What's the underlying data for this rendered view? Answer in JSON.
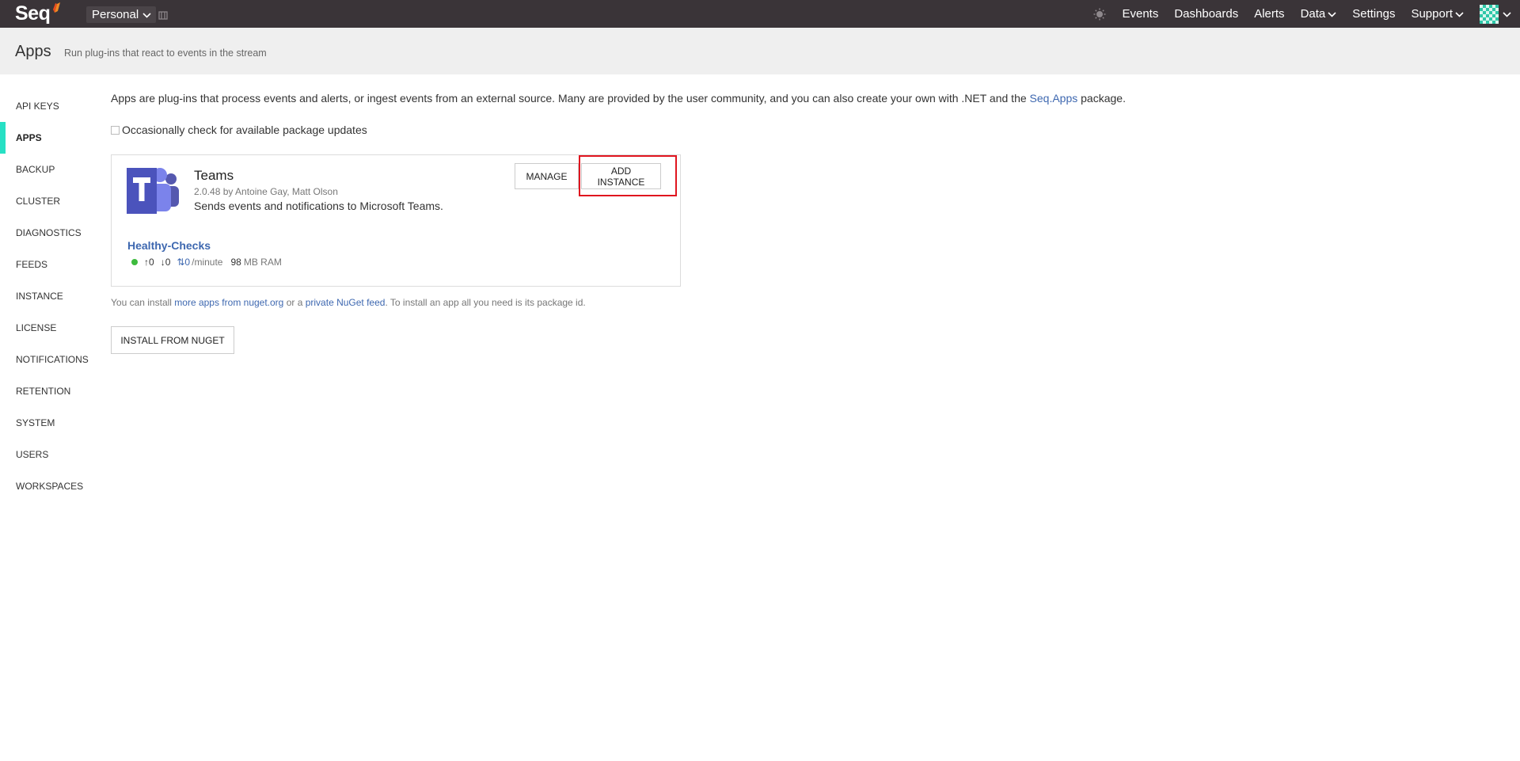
{
  "topbar": {
    "logo_text": "Seq",
    "workspace": "Personal",
    "nav": [
      {
        "label": "Events",
        "has_dropdown": false
      },
      {
        "label": "Dashboards",
        "has_dropdown": false
      },
      {
        "label": "Alerts",
        "has_dropdown": false
      },
      {
        "label": "Data",
        "has_dropdown": true
      },
      {
        "label": "Settings",
        "has_dropdown": false
      },
      {
        "label": "Support",
        "has_dropdown": true
      }
    ]
  },
  "header": {
    "title": "Apps",
    "subtitle": "Run plug-ins that react to events in the stream"
  },
  "sidebar": {
    "items": [
      {
        "label": "API KEYS"
      },
      {
        "label": "APPS",
        "active": true
      },
      {
        "label": "BACKUP"
      },
      {
        "label": "CLUSTER"
      },
      {
        "label": "DIAGNOSTICS"
      },
      {
        "label": "FEEDS"
      },
      {
        "label": "INSTANCE"
      },
      {
        "label": "LICENSE"
      },
      {
        "label": "NOTIFICATIONS"
      },
      {
        "label": "RETENTION"
      },
      {
        "label": "SYSTEM"
      },
      {
        "label": "USERS"
      },
      {
        "label": "WORKSPACES"
      }
    ]
  },
  "main": {
    "intro_before": "Apps are plug-ins that process events and alerts, or ingest events from an external source. Many are provided by the user community, and you can also create your own with .NET and the ",
    "intro_link": "Seq.Apps",
    "intro_after": " package.",
    "check_label": "Occasionally check for available package updates",
    "check_value": false,
    "app": {
      "name": "Teams",
      "meta": "2.0.48 by Antoine Gay, Matt Olson",
      "description": "Sends events and notifications to Microsoft Teams.",
      "manage_label": "MANAGE",
      "add_instance_label": "ADD INSTANCE",
      "instance": {
        "name": "Healthy-Checks",
        "status_color": "#3dbb3d",
        "in": "↑0",
        "out": "↓0",
        "rate": "⇅0",
        "rate_unit": "/minute",
        "ram_value": "98",
        "ram_unit": "MB RAM"
      }
    },
    "install_note_before": "You can install ",
    "install_link1": "more apps from nuget.org",
    "install_note_mid": " or a ",
    "install_link2": "private NuGet feed",
    "install_note_after": ". To install an app all you need is its package id.",
    "install_button": "INSTALL FROM NUGET"
  },
  "colors": {
    "topbar": "#3a3438",
    "accent": "#27e0c4",
    "link": "#3e68b0",
    "highlight": "#e0151f",
    "teams_purple": "#5558af"
  },
  "icons": {
    "logo": "seq-logo-icon",
    "workspace_pin": "pin-icon",
    "theme": "sun-icon",
    "avatar": "user-avatar",
    "app": "microsoft-teams-icon"
  }
}
